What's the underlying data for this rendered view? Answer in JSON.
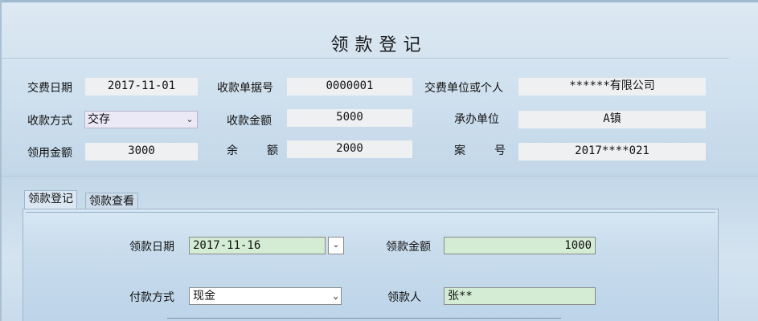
{
  "title": "领款登记",
  "info": {
    "pay_date_label": "交费日期",
    "pay_date_value": "2017-11-01",
    "receipt_no_label": "收款单据号",
    "receipt_no_value": "0000001",
    "payer_label": "交费单位或个人",
    "payer_value": "******有限公司",
    "collect_method_label": "收款方式",
    "collect_method_value": "交存",
    "collect_amount_label": "收款金额",
    "collect_amount_value": "5000",
    "handler_unit_label": "承办单位",
    "handler_unit_value": "A镇",
    "used_amount_label": "领用金额",
    "used_amount_value": "3000",
    "balance_label_a": "余",
    "balance_label_b": "额",
    "balance_value": "2000",
    "case_no_label_a": "案",
    "case_no_label_b": "号",
    "case_no_value": "2017****021"
  },
  "tabs": [
    {
      "label": "领款登记",
      "active": true
    },
    {
      "label": "领款查看",
      "active": false
    }
  ],
  "form": {
    "receive_date_label": "领款日期",
    "receive_date_value": "2017-11-16",
    "receive_amount_label": "领款金额",
    "receive_amount_value": "1000",
    "payment_method_label": "付款方式",
    "payment_method_value": "现金",
    "receiver_label": "领款人",
    "receiver_value": "张**"
  },
  "icons": {
    "dropdown": "chevron-down-icon",
    "date_picker": "date-picker-icon"
  },
  "colors": {
    "green_field": "#d4ecd4",
    "readonly_value": "#eef0f2",
    "select_bg": "#ece9f7"
  }
}
